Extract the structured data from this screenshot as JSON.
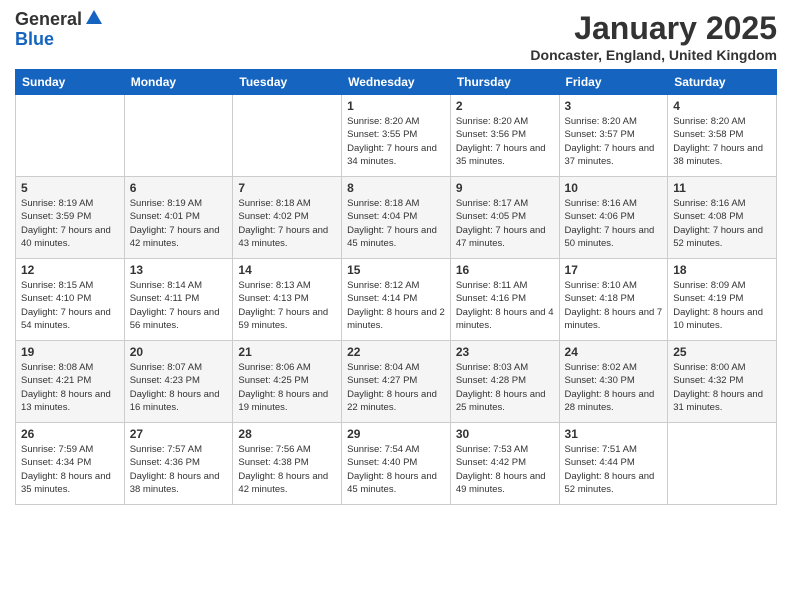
{
  "header": {
    "logo_general": "General",
    "logo_blue": "Blue",
    "month_title": "January 2025",
    "location": "Doncaster, England, United Kingdom"
  },
  "weekdays": [
    "Sunday",
    "Monday",
    "Tuesday",
    "Wednesday",
    "Thursday",
    "Friday",
    "Saturday"
  ],
  "weeks": [
    [
      {
        "day": "",
        "sunrise": "",
        "sunset": "",
        "daylight": ""
      },
      {
        "day": "",
        "sunrise": "",
        "sunset": "",
        "daylight": ""
      },
      {
        "day": "",
        "sunrise": "",
        "sunset": "",
        "daylight": ""
      },
      {
        "day": "1",
        "sunrise": "Sunrise: 8:20 AM",
        "sunset": "Sunset: 3:55 PM",
        "daylight": "Daylight: 7 hours and 34 minutes."
      },
      {
        "day": "2",
        "sunrise": "Sunrise: 8:20 AM",
        "sunset": "Sunset: 3:56 PM",
        "daylight": "Daylight: 7 hours and 35 minutes."
      },
      {
        "day": "3",
        "sunrise": "Sunrise: 8:20 AM",
        "sunset": "Sunset: 3:57 PM",
        "daylight": "Daylight: 7 hours and 37 minutes."
      },
      {
        "day": "4",
        "sunrise": "Sunrise: 8:20 AM",
        "sunset": "Sunset: 3:58 PM",
        "daylight": "Daylight: 7 hours and 38 minutes."
      }
    ],
    [
      {
        "day": "5",
        "sunrise": "Sunrise: 8:19 AM",
        "sunset": "Sunset: 3:59 PM",
        "daylight": "Daylight: 7 hours and 40 minutes."
      },
      {
        "day": "6",
        "sunrise": "Sunrise: 8:19 AM",
        "sunset": "Sunset: 4:01 PM",
        "daylight": "Daylight: 7 hours and 42 minutes."
      },
      {
        "day": "7",
        "sunrise": "Sunrise: 8:18 AM",
        "sunset": "Sunset: 4:02 PM",
        "daylight": "Daylight: 7 hours and 43 minutes."
      },
      {
        "day": "8",
        "sunrise": "Sunrise: 8:18 AM",
        "sunset": "Sunset: 4:04 PM",
        "daylight": "Daylight: 7 hours and 45 minutes."
      },
      {
        "day": "9",
        "sunrise": "Sunrise: 8:17 AM",
        "sunset": "Sunset: 4:05 PM",
        "daylight": "Daylight: 7 hours and 47 minutes."
      },
      {
        "day": "10",
        "sunrise": "Sunrise: 8:16 AM",
        "sunset": "Sunset: 4:06 PM",
        "daylight": "Daylight: 7 hours and 50 minutes."
      },
      {
        "day": "11",
        "sunrise": "Sunrise: 8:16 AM",
        "sunset": "Sunset: 4:08 PM",
        "daylight": "Daylight: 7 hours and 52 minutes."
      }
    ],
    [
      {
        "day": "12",
        "sunrise": "Sunrise: 8:15 AM",
        "sunset": "Sunset: 4:10 PM",
        "daylight": "Daylight: 7 hours and 54 minutes."
      },
      {
        "day": "13",
        "sunrise": "Sunrise: 8:14 AM",
        "sunset": "Sunset: 4:11 PM",
        "daylight": "Daylight: 7 hours and 56 minutes."
      },
      {
        "day": "14",
        "sunrise": "Sunrise: 8:13 AM",
        "sunset": "Sunset: 4:13 PM",
        "daylight": "Daylight: 7 hours and 59 minutes."
      },
      {
        "day": "15",
        "sunrise": "Sunrise: 8:12 AM",
        "sunset": "Sunset: 4:14 PM",
        "daylight": "Daylight: 8 hours and 2 minutes."
      },
      {
        "day": "16",
        "sunrise": "Sunrise: 8:11 AM",
        "sunset": "Sunset: 4:16 PM",
        "daylight": "Daylight: 8 hours and 4 minutes."
      },
      {
        "day": "17",
        "sunrise": "Sunrise: 8:10 AM",
        "sunset": "Sunset: 4:18 PM",
        "daylight": "Daylight: 8 hours and 7 minutes."
      },
      {
        "day": "18",
        "sunrise": "Sunrise: 8:09 AM",
        "sunset": "Sunset: 4:19 PM",
        "daylight": "Daylight: 8 hours and 10 minutes."
      }
    ],
    [
      {
        "day": "19",
        "sunrise": "Sunrise: 8:08 AM",
        "sunset": "Sunset: 4:21 PM",
        "daylight": "Daylight: 8 hours and 13 minutes."
      },
      {
        "day": "20",
        "sunrise": "Sunrise: 8:07 AM",
        "sunset": "Sunset: 4:23 PM",
        "daylight": "Daylight: 8 hours and 16 minutes."
      },
      {
        "day": "21",
        "sunrise": "Sunrise: 8:06 AM",
        "sunset": "Sunset: 4:25 PM",
        "daylight": "Daylight: 8 hours and 19 minutes."
      },
      {
        "day": "22",
        "sunrise": "Sunrise: 8:04 AM",
        "sunset": "Sunset: 4:27 PM",
        "daylight": "Daylight: 8 hours and 22 minutes."
      },
      {
        "day": "23",
        "sunrise": "Sunrise: 8:03 AM",
        "sunset": "Sunset: 4:28 PM",
        "daylight": "Daylight: 8 hours and 25 minutes."
      },
      {
        "day": "24",
        "sunrise": "Sunrise: 8:02 AM",
        "sunset": "Sunset: 4:30 PM",
        "daylight": "Daylight: 8 hours and 28 minutes."
      },
      {
        "day": "25",
        "sunrise": "Sunrise: 8:00 AM",
        "sunset": "Sunset: 4:32 PM",
        "daylight": "Daylight: 8 hours and 31 minutes."
      }
    ],
    [
      {
        "day": "26",
        "sunrise": "Sunrise: 7:59 AM",
        "sunset": "Sunset: 4:34 PM",
        "daylight": "Daylight: 8 hours and 35 minutes."
      },
      {
        "day": "27",
        "sunrise": "Sunrise: 7:57 AM",
        "sunset": "Sunset: 4:36 PM",
        "daylight": "Daylight: 8 hours and 38 minutes."
      },
      {
        "day": "28",
        "sunrise": "Sunrise: 7:56 AM",
        "sunset": "Sunset: 4:38 PM",
        "daylight": "Daylight: 8 hours and 42 minutes."
      },
      {
        "day": "29",
        "sunrise": "Sunrise: 7:54 AM",
        "sunset": "Sunset: 4:40 PM",
        "daylight": "Daylight: 8 hours and 45 minutes."
      },
      {
        "day": "30",
        "sunrise": "Sunrise: 7:53 AM",
        "sunset": "Sunset: 4:42 PM",
        "daylight": "Daylight: 8 hours and 49 minutes."
      },
      {
        "day": "31",
        "sunrise": "Sunrise: 7:51 AM",
        "sunset": "Sunset: 4:44 PM",
        "daylight": "Daylight: 8 hours and 52 minutes."
      },
      {
        "day": "",
        "sunrise": "",
        "sunset": "",
        "daylight": ""
      }
    ]
  ]
}
